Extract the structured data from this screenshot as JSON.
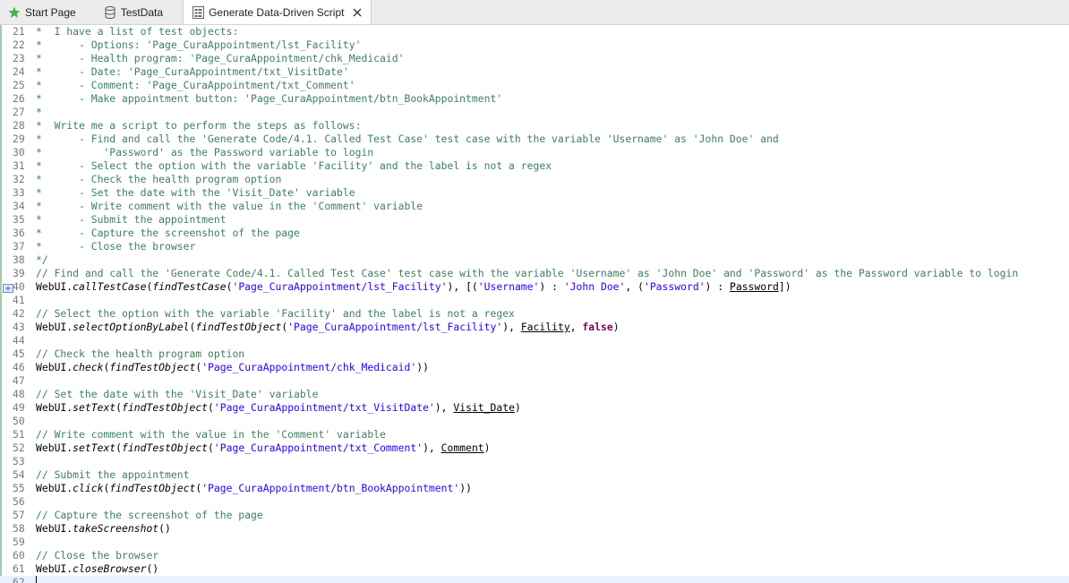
{
  "tabs": [
    {
      "label": "Start Page",
      "icon": "star-icon",
      "active": false
    },
    {
      "label": "TestData",
      "icon": "database-icon",
      "active": false
    },
    {
      "label": "Generate Data-Driven Script",
      "icon": "script-file-icon",
      "active": true
    }
  ],
  "colors": {
    "comment": "#3f7f5f",
    "string": "#2a00ff",
    "keyword": "#7f0055",
    "line_highlight": "#e8f2fe"
  },
  "lines": [
    {
      "n": "21",
      "t": "*  I have a list of test objects:"
    },
    {
      "n": "22",
      "t": "*      - Options: 'Page_CuraAppointment/lst_Facility'"
    },
    {
      "n": "23",
      "t": "*      - Health program: 'Page_CuraAppointment/chk_Medicaid'"
    },
    {
      "n": "24",
      "t": "*      - Date: 'Page_CuraAppointment/txt_VisitDate'"
    },
    {
      "n": "25",
      "t": "*      - Comment: 'Page_CuraAppointment/txt_Comment'"
    },
    {
      "n": "26",
      "t": "*      - Make appointment button: 'Page_CuraAppointment/btn_BookAppointment'"
    },
    {
      "n": "27",
      "t": "*"
    },
    {
      "n": "28",
      "t": "*  Write me a script to perform the steps as follows:"
    },
    {
      "n": "29",
      "t": "*      - Find and call the 'Generate Code/4.1. Called Test Case' test case with the variable 'Username' as 'John Doe' and"
    },
    {
      "n": "30",
      "t": "*          'Password' as the Password variable to login"
    },
    {
      "n": "31",
      "t": "*      - Select the option with the variable 'Facility' and the label is not a regex"
    },
    {
      "n": "32",
      "t": "*      - Check the health program option"
    },
    {
      "n": "33",
      "t": "*      - Set the date with the 'Visit_Date' variable"
    },
    {
      "n": "34",
      "t": "*      - Write comment with the value in the 'Comment' variable"
    },
    {
      "n": "35",
      "t": "*      - Submit the appointment"
    },
    {
      "n": "36",
      "t": "*      - Capture the screenshot of the page"
    },
    {
      "n": "37",
      "t": "*      - Close the browser"
    },
    {
      "n": "38",
      "t": "*/"
    },
    {
      "n": "39",
      "t": "// Find and call the 'Generate Code/4.1. Called Test Case' test case with the variable 'Username' as 'John Doe' and 'Password' as the Password variable to login"
    },
    {
      "n": "40",
      "t": "WebUI.callTestCase(findTestCase('Page_CuraAppointment/lst_Facility'), [('Username') : 'John Doe', ('Password') : Password])",
      "marker": true
    },
    {
      "n": "41",
      "t": ""
    },
    {
      "n": "42",
      "t": "// Select the option with the variable 'Facility' and the label is not a regex"
    },
    {
      "n": "43",
      "t": "WebUI.selectOptionByLabel(findTestObject('Page_CuraAppointment/lst_Facility'), Facility, false)"
    },
    {
      "n": "44",
      "t": ""
    },
    {
      "n": "45",
      "t": "// Check the health program option"
    },
    {
      "n": "46",
      "t": "WebUI.check(findTestObject('Page_CuraAppointment/chk_Medicaid'))"
    },
    {
      "n": "47",
      "t": ""
    },
    {
      "n": "48",
      "t": "// Set the date with the 'Visit_Date' variable"
    },
    {
      "n": "49",
      "t": "WebUI.setText(findTestObject('Page_CuraAppointment/txt_VisitDate'), Visit_Date)"
    },
    {
      "n": "50",
      "t": ""
    },
    {
      "n": "51",
      "t": "// Write comment with the value in the 'Comment' variable"
    },
    {
      "n": "52",
      "t": "WebUI.setText(findTestObject('Page_CuraAppointment/txt_Comment'), Comment)"
    },
    {
      "n": "53",
      "t": ""
    },
    {
      "n": "54",
      "t": "// Submit the appointment"
    },
    {
      "n": "55",
      "t": "WebUI.click(findTestObject('Page_CuraAppointment/btn_BookAppointment'))"
    },
    {
      "n": "56",
      "t": ""
    },
    {
      "n": "57",
      "t": "// Capture the screenshot of the page"
    },
    {
      "n": "58",
      "t": "WebUI.takeScreenshot()"
    },
    {
      "n": "59",
      "t": ""
    },
    {
      "n": "60",
      "t": "// Close the browser"
    },
    {
      "n": "61",
      "t": "WebUI.closeBrowser()"
    },
    {
      "n": "62",
      "t": "",
      "current": true
    }
  ],
  "variables": [
    "Password",
    "Facility",
    "Visit_Date",
    "Comment"
  ],
  "keywords": [
    "false"
  ]
}
